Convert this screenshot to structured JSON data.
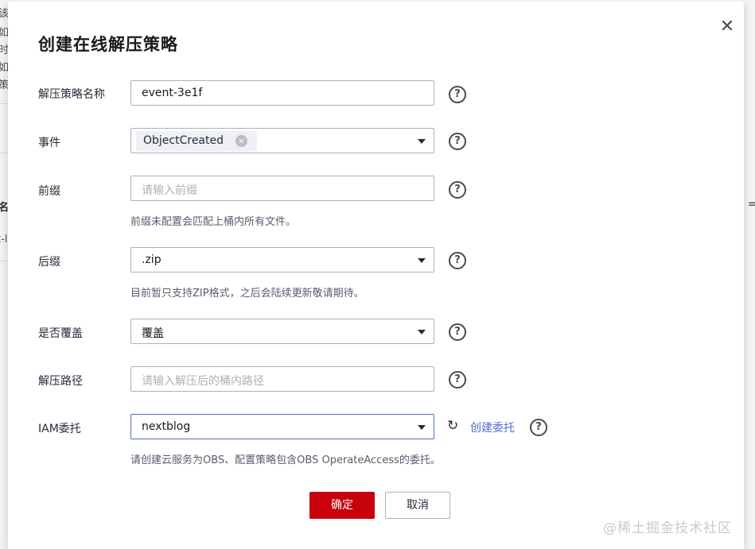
{
  "background": {
    "fragments": [
      "该",
      "如",
      "时",
      "如",
      "策",
      "名",
      "t-l",
      "="
    ]
  },
  "dialog": {
    "title": "创建在线解压策略",
    "close_icon": "close-icon"
  },
  "form": {
    "policy_name": {
      "label": "解压策略名称",
      "value": "event-3e1f"
    },
    "event": {
      "label": "事件",
      "tag": "ObjectCreated",
      "remove_icon": "×"
    },
    "prefix": {
      "label": "前缀",
      "placeholder": "请输入前缀",
      "hint": "前缀未配置会匹配上桶内所有文件。"
    },
    "suffix": {
      "label": "后缀",
      "value": ".zip",
      "hint": "目前暂只支持ZIP格式，之后会陆续更新敬请期待。"
    },
    "overwrite": {
      "label": "是否覆盖",
      "value": "覆盖"
    },
    "path": {
      "label": "解压路径",
      "placeholder": "请输入解压后的桶内路径"
    },
    "iam": {
      "label": "IAM委托",
      "value": "nextblog",
      "refresh_icon": "↻",
      "create_link": "创建委托",
      "hint": "请创建云服务为OBS、配置策略包含OBS OperateAccess的委托。"
    },
    "help_icon": "?"
  },
  "buttons": {
    "confirm": "确定",
    "cancel": "取消"
  },
  "watermark": "@稀土掘金技术社区",
  "colors": {
    "primary": "#c7000b",
    "link": "#526ecc",
    "border": "#adb0b8"
  }
}
